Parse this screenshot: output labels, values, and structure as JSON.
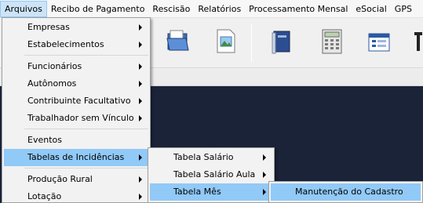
{
  "menubar": {
    "items": [
      "Arquivos",
      "Recibo de Pagamento",
      "Rescisão",
      "Relatórios",
      "Processamento Mensal",
      "eSocial",
      "GPS"
    ]
  },
  "arquivos_menu": {
    "items": [
      "Empresas",
      "Estabelecimentos",
      "Funcionários",
      "Autônomos",
      "Contribuinte Facultativo",
      "Trabalhador sem Vínculo",
      "Eventos",
      "Tabelas de Incidências",
      "Produção Rural",
      "Lotação"
    ]
  },
  "incidencias_menu": {
    "items": [
      "Tabela Salário",
      "Tabela Salário Aula",
      "Tabela Mês"
    ]
  },
  "tabela_mes_menu": {
    "items": [
      "Manutenção do Cadastro"
    ]
  },
  "colors": {
    "highlight": "#91c9f7",
    "menubar_active": "#cce4f7",
    "desktop": "#1b2339"
  },
  "toolbar": {
    "icons": [
      "folder-open-icon",
      "image-document-icon",
      "book-icon",
      "calculator-icon",
      "window-list-icon"
    ]
  }
}
